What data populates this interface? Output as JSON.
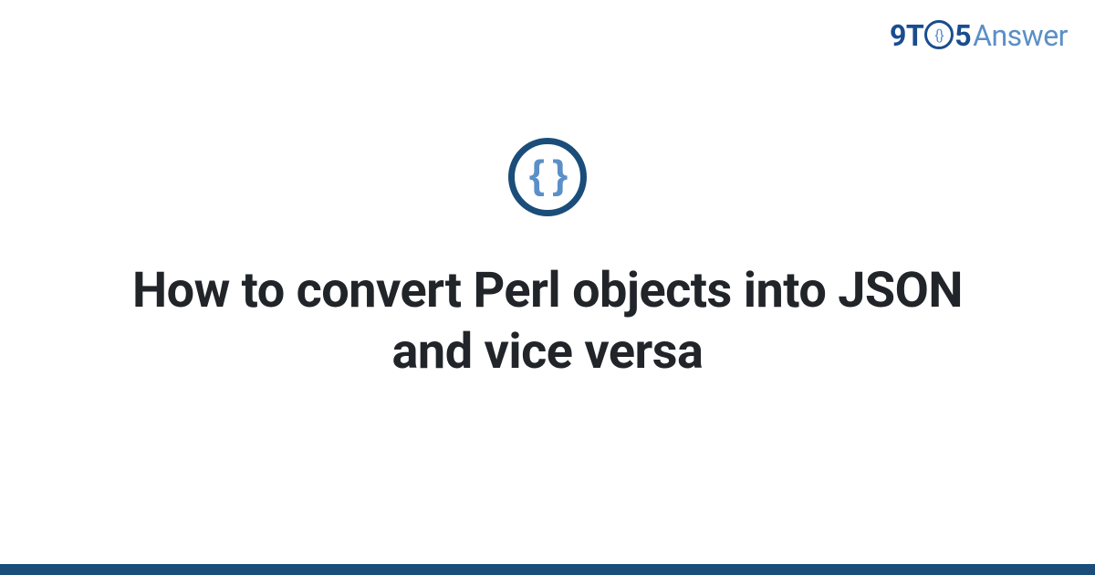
{
  "logo": {
    "part1": "9T",
    "circle_inner": "{}",
    "part2": "5",
    "part3": "Answer"
  },
  "icon": {
    "symbol": "{ }",
    "name": "code-braces-icon"
  },
  "title": "How to convert Perl objects into JSON and vice versa",
  "colors": {
    "primary_dark": "#1a4d7a",
    "primary_light": "#5b8fc7",
    "text": "#212529"
  }
}
